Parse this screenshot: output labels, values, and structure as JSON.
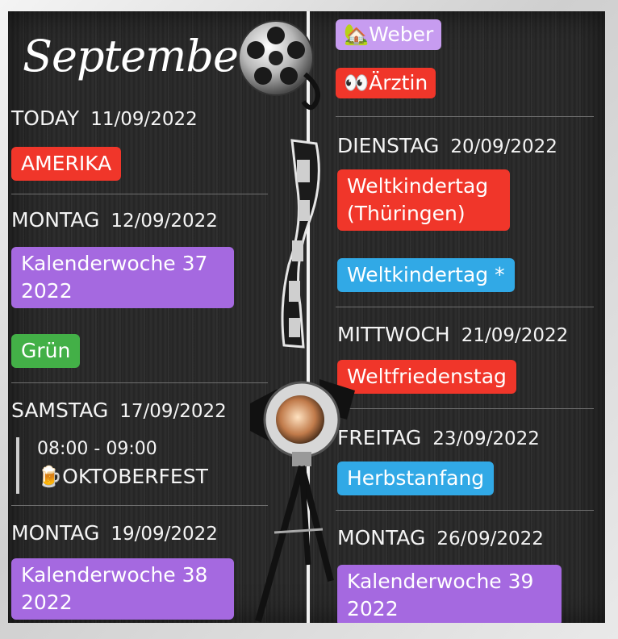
{
  "title": "September",
  "left": {
    "days": [
      {
        "weekday": "TODAY",
        "date": "11/09/2022",
        "events": [
          "AMERIKA"
        ]
      },
      {
        "weekday": "MONTAG",
        "date": "12/09/2022",
        "events": [
          "Kalenderwoche 37 2022",
          "Grün"
        ]
      },
      {
        "weekday": "SAMSTAG",
        "date": "17/09/2022",
        "timed_event": {
          "time": "08:00 - 09:00",
          "icon": "beer-mug-icon",
          "label": "OKTOBERFEST"
        }
      },
      {
        "weekday": "MONTAG",
        "date": "19/09/2022",
        "events": [
          "Kalenderwoche 38 2022"
        ]
      }
    ]
  },
  "right": {
    "top_events": [
      {
        "icon": "house-tree-icon",
        "label": "Weber"
      },
      {
        "icon": "eyes-icon",
        "label": "Ärztin"
      }
    ],
    "days": [
      {
        "weekday": "DIENSTAG",
        "date": "20/09/2022",
        "events": [
          "Weltkindertag (Thüringen)",
          "Weltkindertag *"
        ]
      },
      {
        "weekday": "MITTWOCH",
        "date": "21/09/2022",
        "events": [
          "Weltfriedenstag"
        ]
      },
      {
        "weekday": "FREITAG",
        "date": "23/09/2022",
        "events": [
          "Herbstanfang"
        ]
      },
      {
        "weekday": "MONTAG",
        "date": "26/09/2022",
        "events": [
          "Kalenderwoche 39 2022"
        ]
      }
    ]
  },
  "colors": {
    "red": "#f0362a",
    "purple": "#a569e0",
    "green": "#43b047",
    "blue": "#31a9e6",
    "lavender": "#c79cf0",
    "board": "#242424"
  },
  "decorations": [
    "film-reel-icon",
    "film-strip-icon",
    "stage-spotlight-icon"
  ]
}
